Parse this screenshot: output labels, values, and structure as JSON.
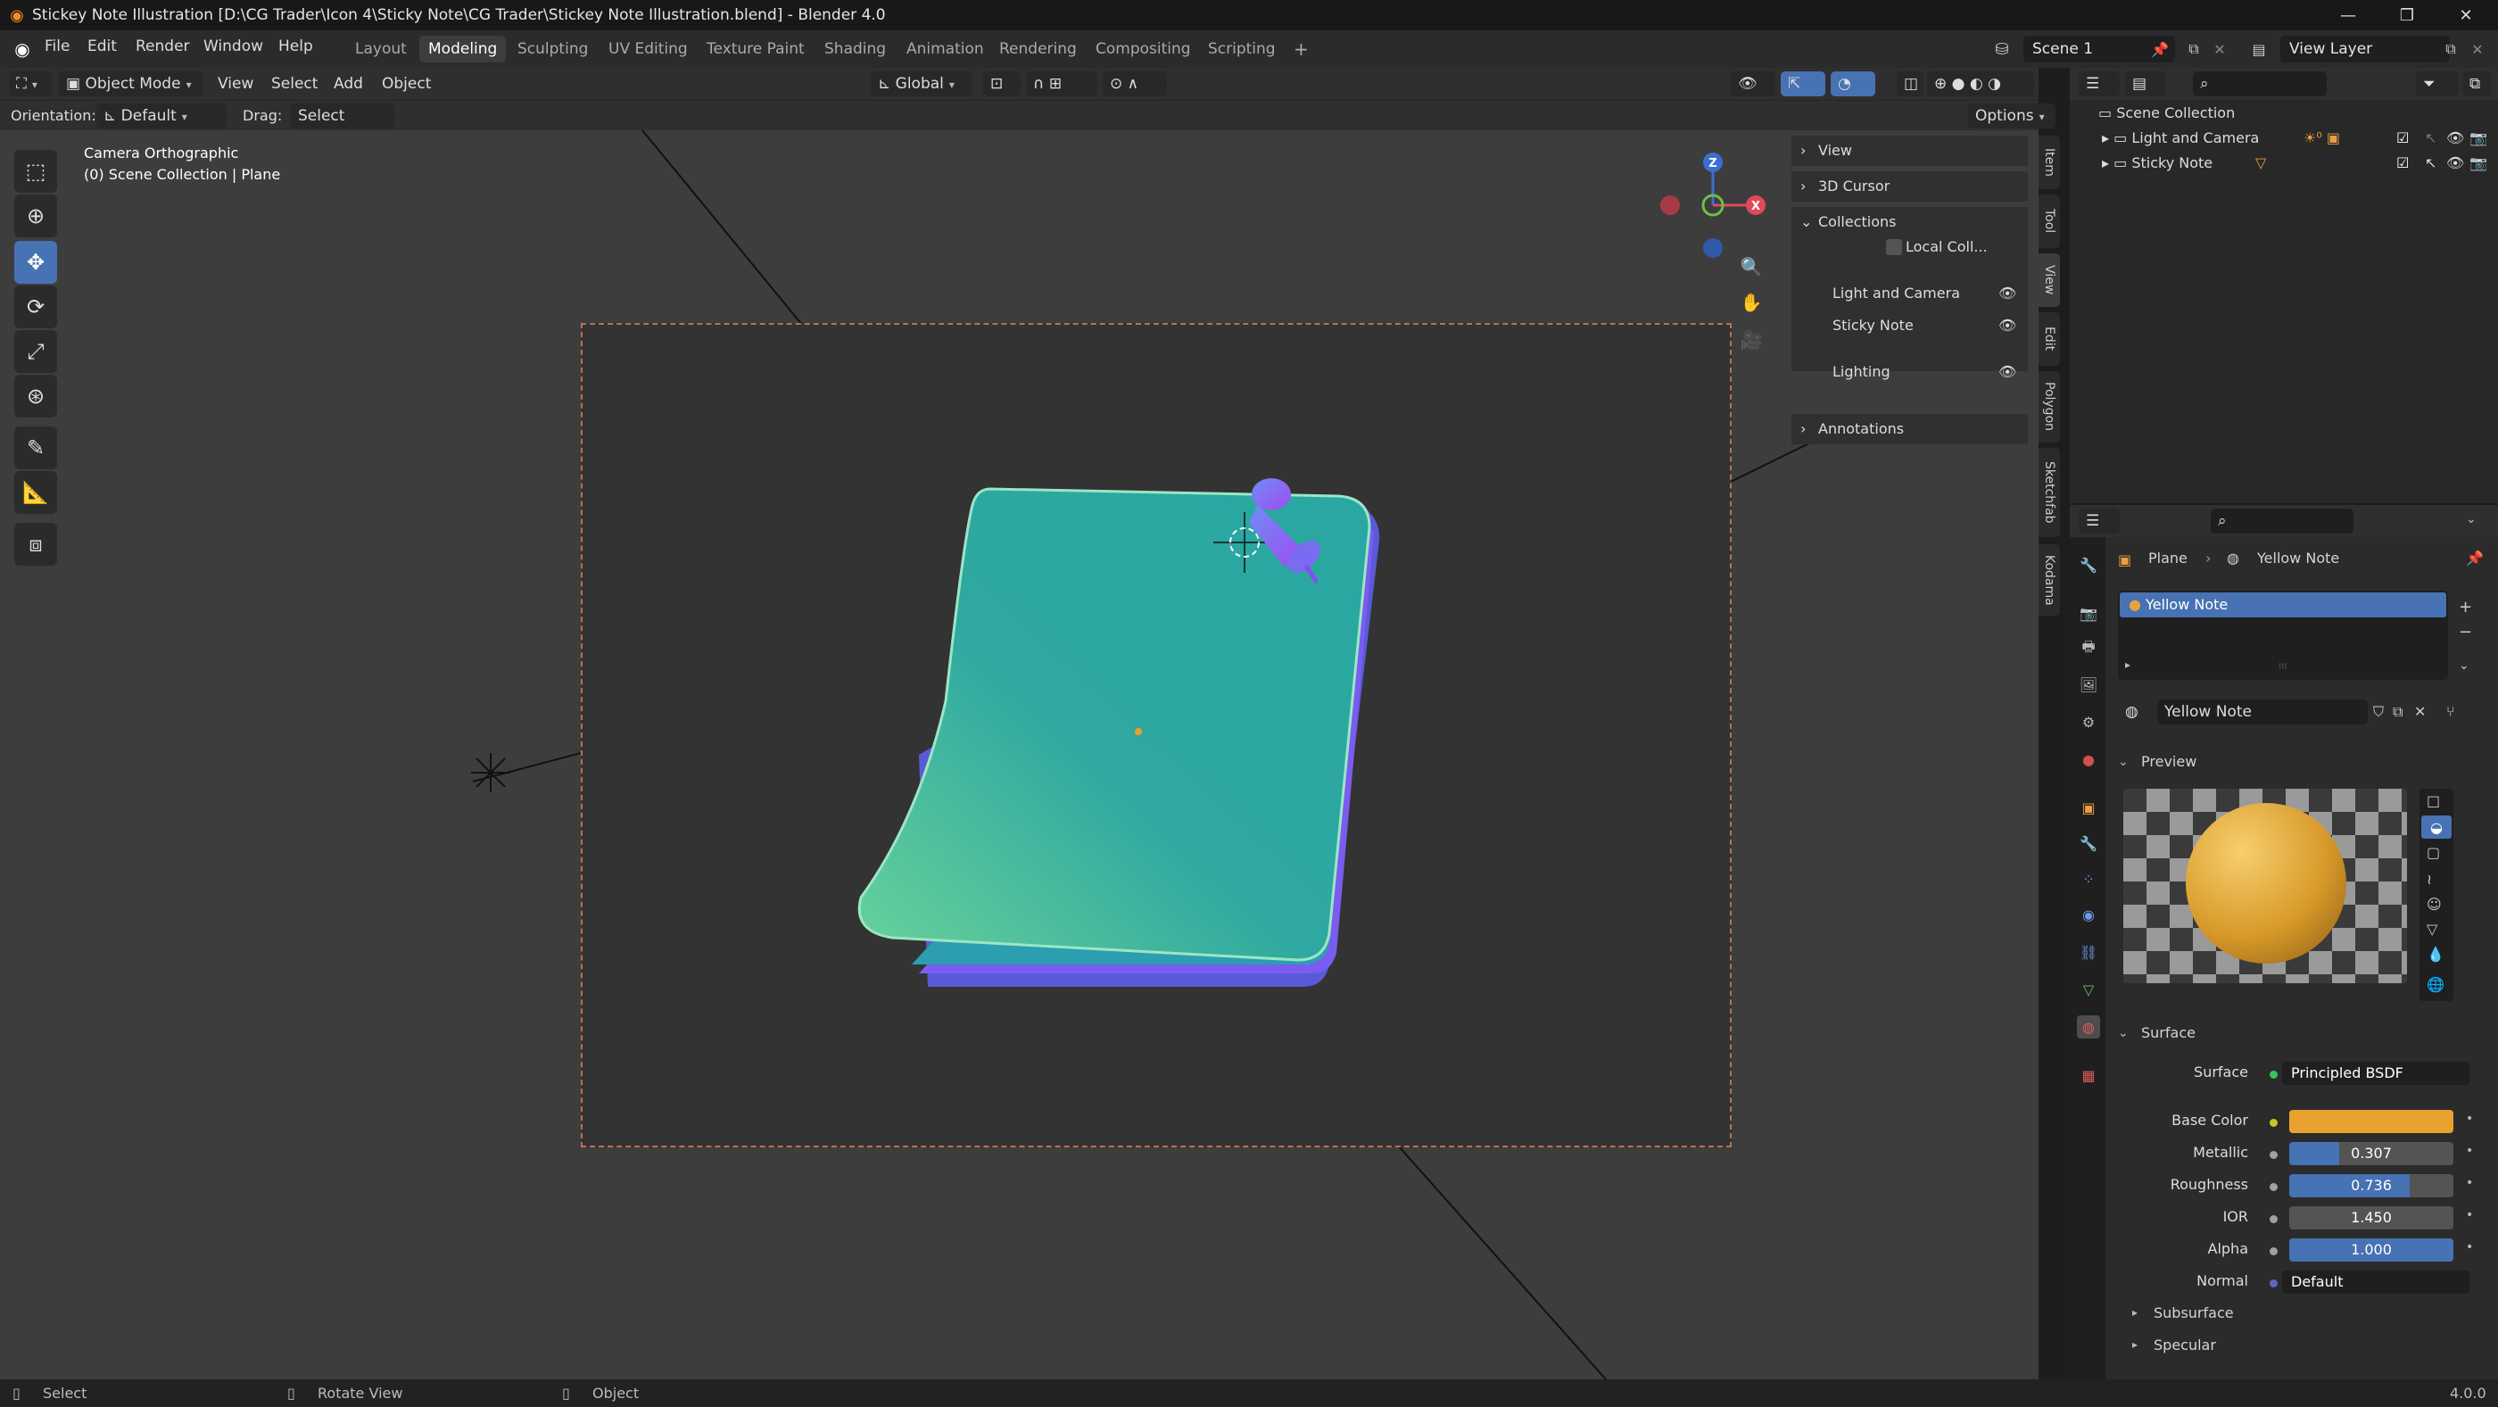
{
  "window": {
    "title": "Stickey Note Illustration [D:\\CG Trader\\Icon 4\\Sticky Note\\CG Trader\\Stickey Note Illustration.blend] - Blender 4.0",
    "controls": [
      "—",
      "❐",
      "✕"
    ]
  },
  "menu": {
    "items": [
      "File",
      "Edit",
      "Render",
      "Window",
      "Help"
    ],
    "workspaces": [
      "Layout",
      "Modeling",
      "Sculpting",
      "UV Editing",
      "Texture Paint",
      "Shading",
      "Animation",
      "Rendering",
      "Compositing",
      "Scripting"
    ],
    "active_workspace": "Modeling",
    "add_workspace": "+",
    "scene": "Scene 1",
    "view_layer": "View Layer"
  },
  "viewport_header": {
    "mode": "Object Mode",
    "menus": [
      "View",
      "Select",
      "Add",
      "Object"
    ],
    "transform_orientation": "Global",
    "options_label": "Options",
    "orientation_label": "Orientation:",
    "orientation_value": "Default",
    "drag_label": "Drag:",
    "drag_value": "Select Box"
  },
  "viewport": {
    "overlay_line1": "Camera Orthographic",
    "overlay_line2": "(0) Scene Collection | Plane",
    "gizmo_labels": {
      "z": "Z",
      "x": "X"
    }
  },
  "npanel": {
    "sections": [
      "View",
      "3D Cursor",
      "Collections",
      "Annotations"
    ],
    "local_collections": "Local Coll...",
    "collections": [
      "Light and Camera",
      "Sticky Note",
      "Lighting"
    ],
    "side_tabs": [
      "Item",
      "Tool",
      "View",
      "Edit",
      "Polygon",
      "Sketchfab",
      "Kodama"
    ]
  },
  "outliner": {
    "root": "Scene Collection",
    "rows": [
      "Light and Camera",
      "Sticky Note"
    ]
  },
  "properties": {
    "breadcrumb_object": "Plane",
    "breadcrumb_material": "Yellow Note",
    "slot_name": "Yellow Note",
    "material_name": "Yellow Note",
    "preview_label": "Preview",
    "surface_label": "Surface",
    "fields": {
      "surface": {
        "label": "Surface",
        "value": "Principled BSDF"
      },
      "base_color": {
        "label": "Base Color",
        "color": "#e8a02e"
      },
      "metallic": {
        "label": "Metallic",
        "value": "0.307",
        "fraction": 0.307
      },
      "roughness": {
        "label": "Roughness",
        "value": "0.736",
        "fraction": 0.736
      },
      "ior": {
        "label": "IOR",
        "value": "1.450"
      },
      "alpha": {
        "label": "Alpha",
        "value": "1.000",
        "fraction": 1.0
      },
      "normal": {
        "label": "Normal",
        "value": "Default"
      }
    },
    "subpanels": [
      "Subsurface",
      "Specular"
    ]
  },
  "statusbar": {
    "items": [
      "Select",
      "Rotate View",
      "Object"
    ],
    "version": "4.0.0"
  },
  "colors": {
    "accent": "#4772b3",
    "note_top": "#2aa7a3",
    "note_bottom": "#6ad39b",
    "pin": "#8a4cf0"
  }
}
